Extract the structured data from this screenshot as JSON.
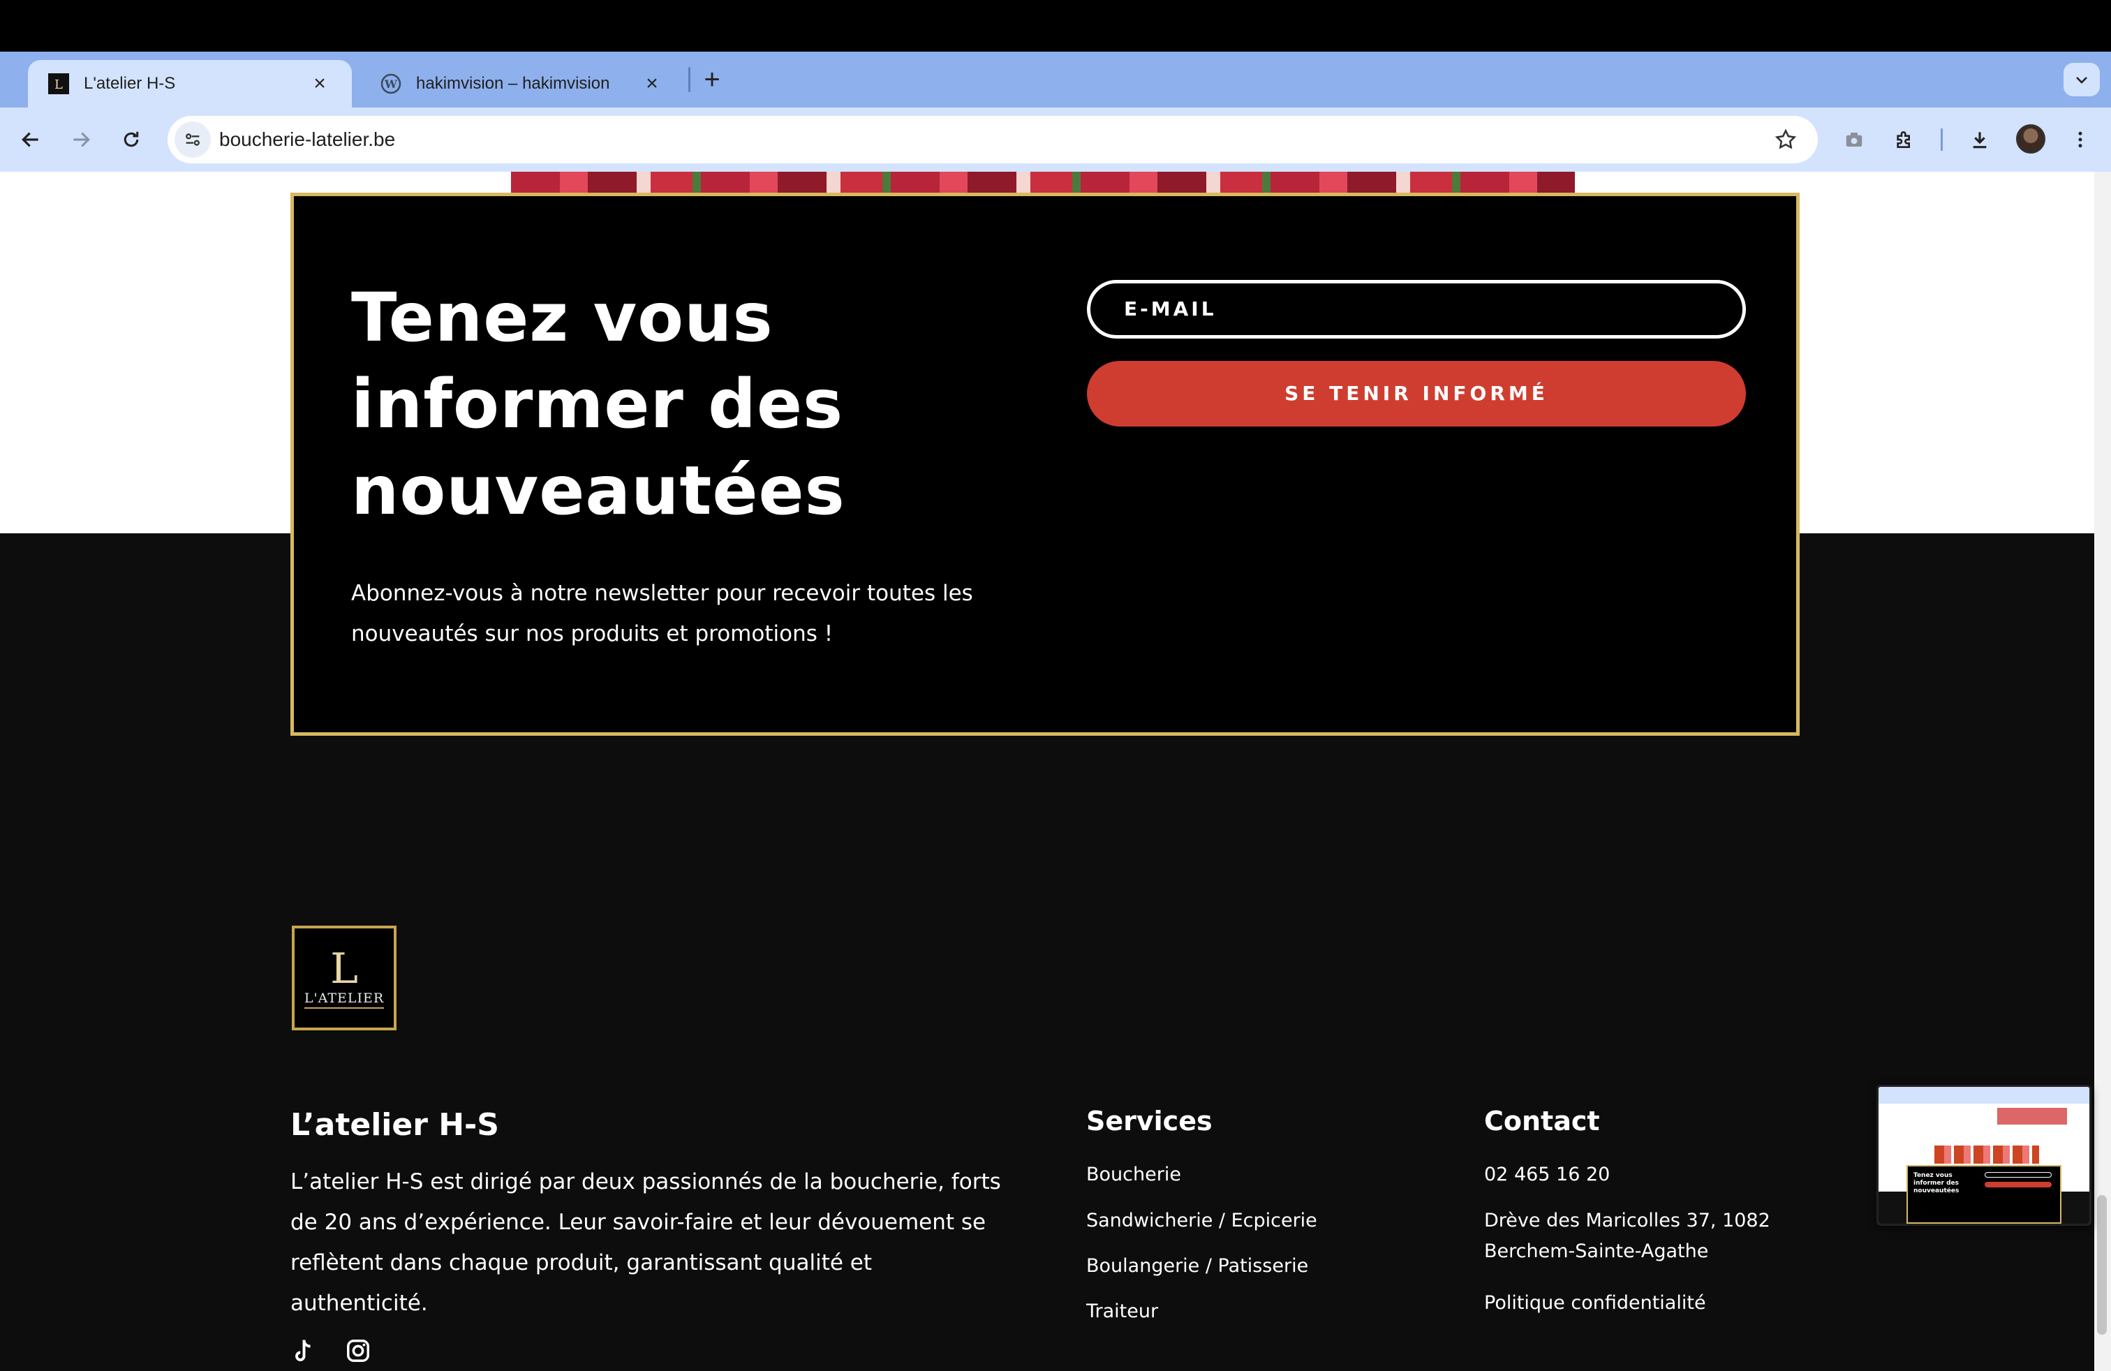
{
  "browser": {
    "tabs": [
      {
        "title": "L'atelier H-S",
        "active": true
      },
      {
        "title": "hakimvision – hakimvision",
        "active": false
      }
    ],
    "url": "boucherie-latelier.be"
  },
  "newsletter": {
    "title": "Tenez vous informer des nouveautées",
    "subtitle": "Abonnez-vous à notre newsletter pour recevoir toutes les nouveautés sur nos produits et promotions !",
    "email_placeholder": "E-MAIL",
    "button_label": "SE TENIR INFORMÉ"
  },
  "footer": {
    "logo": {
      "monogram": "L",
      "name": "L'ATELIER"
    },
    "title": "L’atelier H-S",
    "description": "L’atelier H-S est dirigé par deux passionnés de la boucherie, forts de 20 ans d’expérience. Leur savoir-faire et leur dévouement se reflètent dans chaque produit, garantissant qualité et authenticité.",
    "services": {
      "title": "Services",
      "items": [
        "Boucherie",
        "Sandwicherie / Ecpicerie",
        "Boulangerie / Patisserie",
        "Traiteur"
      ]
    },
    "contact": {
      "title": "Contact",
      "phone": "02 465 16 20",
      "address_line1": "Drève des Maricolles 37, 1082",
      "address_line2": "Berchem-Sainte-Agathe",
      "privacy": "Politique confidentialité"
    }
  },
  "preview": {
    "text": "Tenez vous informer des nouveautées"
  },
  "colors": {
    "accent_red": "#cf3d31",
    "gold_border": "#d8b860",
    "chrome_blue": "#d3e3fd"
  }
}
